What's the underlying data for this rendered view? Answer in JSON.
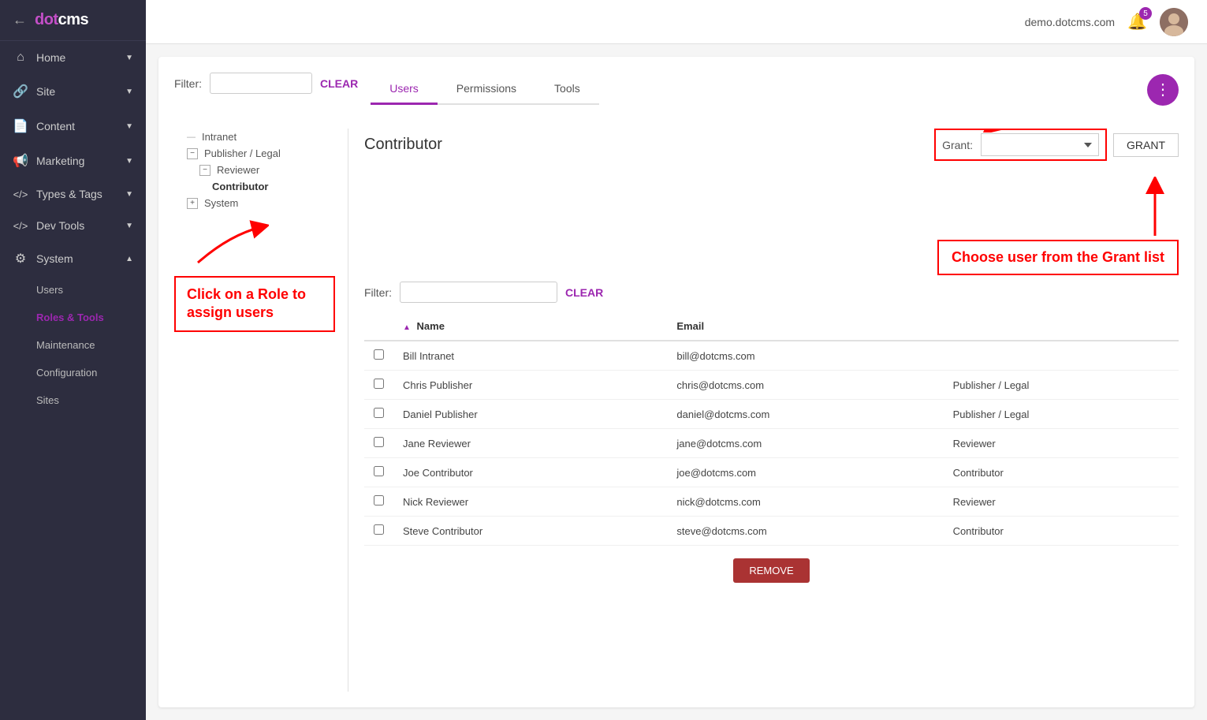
{
  "app": {
    "title": "dotCMS",
    "domain": "demo.dotcms.com",
    "badge_count": "5"
  },
  "sidebar": {
    "back_label": "←",
    "logo": "dotCMS",
    "items": [
      {
        "id": "home",
        "label": "Home",
        "icon": "🏠",
        "has_arrow": true
      },
      {
        "id": "site",
        "label": "Site",
        "icon": "🔗",
        "has_arrow": true
      },
      {
        "id": "content",
        "label": "Content",
        "icon": "📄",
        "has_arrow": true
      },
      {
        "id": "marketing",
        "label": "Marketing",
        "icon": "📢",
        "has_arrow": true
      },
      {
        "id": "types-tags",
        "label": "Types & Tags",
        "icon": "</>",
        "has_arrow": true
      },
      {
        "id": "dev-tools",
        "label": "Dev Tools",
        "icon": "</>",
        "has_arrow": true
      },
      {
        "id": "system",
        "label": "System",
        "icon": "⚙",
        "has_arrow": true
      }
    ],
    "system_sub": [
      {
        "id": "users",
        "label": "Users",
        "active": false
      },
      {
        "id": "roles-tools",
        "label": "Roles & Tools",
        "active": true
      },
      {
        "id": "maintenance",
        "label": "Maintenance",
        "active": false
      },
      {
        "id": "configuration",
        "label": "Configuration",
        "active": false
      },
      {
        "id": "sites",
        "label": "Sites",
        "active": false
      }
    ]
  },
  "filter": {
    "label": "Filter:",
    "placeholder": "",
    "clear_label": "CLEAR"
  },
  "tabs": [
    {
      "id": "users",
      "label": "Users",
      "active": true
    },
    {
      "id": "permissions",
      "label": "Permissions",
      "active": false
    },
    {
      "id": "tools",
      "label": "Tools",
      "active": false
    }
  ],
  "tree": {
    "items": [
      {
        "id": "intranet",
        "label": "Intranet",
        "level": 1,
        "has_toggle": false
      },
      {
        "id": "publisher-legal",
        "label": "Publisher / Legal",
        "level": 1,
        "has_toggle": true,
        "expanded": true
      },
      {
        "id": "reviewer",
        "label": "Reviewer",
        "level": 2,
        "has_toggle": true,
        "expanded": true
      },
      {
        "id": "contributor",
        "label": "Contributor",
        "level": 3,
        "has_toggle": false,
        "selected": true
      },
      {
        "id": "system",
        "label": "System",
        "level": 1,
        "has_toggle": true,
        "expanded": false
      }
    ]
  },
  "annotation": {
    "click_role": "Click on a Role to assign users",
    "choose_user": "Choose user from the Grant list"
  },
  "role_panel": {
    "title": "Contributor",
    "grant_label": "Grant:",
    "grant_button": "GRANT",
    "inner_filter_label": "Filter:",
    "inner_clear": "CLEAR",
    "more_icon": "⋮",
    "columns": {
      "name": "Name",
      "email": "Email",
      "role": ""
    },
    "users": [
      {
        "name": "Bill Intranet",
        "email": "bill@dotcms.com",
        "role": "",
        "checked": false
      },
      {
        "name": "Chris Publisher",
        "email": "chris@dotcms.com",
        "role": "Publisher / Legal",
        "checked": false
      },
      {
        "name": "Daniel Publisher",
        "email": "daniel@dotcms.com",
        "role": "Publisher / Legal",
        "checked": false
      },
      {
        "name": "Jane Reviewer",
        "email": "jane@dotcms.com",
        "role": "Reviewer",
        "checked": false
      },
      {
        "name": "Joe Contributor",
        "email": "joe@dotcms.com",
        "role": "Contributor",
        "checked": false
      },
      {
        "name": "Nick Reviewer",
        "email": "nick@dotcms.com",
        "role": "Reviewer",
        "checked": false
      },
      {
        "name": "Steve Contributor",
        "email": "steve@dotcms.com",
        "role": "Contributor",
        "checked": false
      }
    ],
    "remove_button": "REMOVE"
  }
}
